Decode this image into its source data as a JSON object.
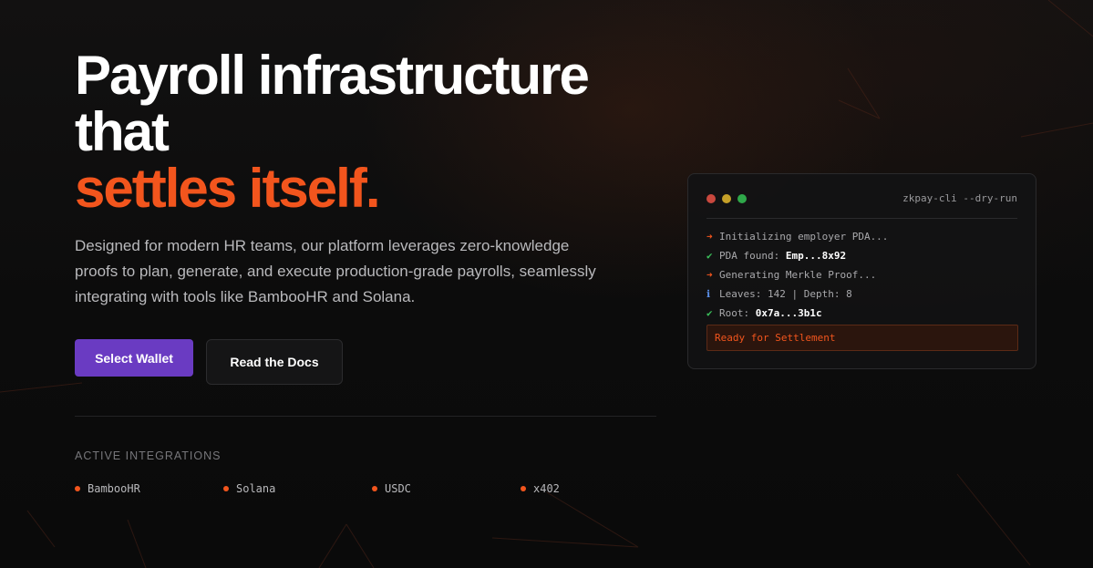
{
  "colors": {
    "accent": "#f2551d",
    "primary_button": "#6a3bc2",
    "background": "#0b0b0c",
    "term_red": "#c9483e",
    "term_yellow": "#c5a028",
    "term_green": "#2fa84a",
    "check_green": "#3bbf5a",
    "info_blue": "#5a8ee6"
  },
  "hero": {
    "line1": "Payroll infrastructure",
    "line2": "that",
    "line3": "settles itself.",
    "subtitle": "Designed for modern HR teams, our platform leverages zero-knowledge proofs to plan, generate, and execute production-grade payrolls, seamlessly integrating with tools like BambooHR and Solana."
  },
  "buttons": {
    "primary_label": "Select Wallet",
    "secondary_label": "Read the Docs"
  },
  "integrations": {
    "title": "ACTIVE INTEGRATIONS",
    "items": [
      {
        "label": "BambooHR",
        "icon": "orange-dot"
      },
      {
        "label": "Solana",
        "icon": "orange-dot"
      },
      {
        "label": "USDC",
        "icon": "orange-dot"
      },
      {
        "label": "x402",
        "icon": "orange-dot"
      }
    ]
  },
  "terminal": {
    "title": "zkpay-cli --dry-run",
    "lines": [
      {
        "symbol": "➜",
        "symbol_color": "#f2551d",
        "text": "Initializing employer PDA...",
        "value": ""
      },
      {
        "symbol": "✔",
        "symbol_color": "#3bbf5a",
        "text": "PDA found: ",
        "value": "Emp...8x92"
      },
      {
        "symbol": "➜",
        "symbol_color": "#f2551d",
        "text": "Generating Merkle Proof...",
        "value": ""
      },
      {
        "symbol": "ℹ",
        "symbol_color": "#5a8ee6",
        "text": "Leaves: 142 | Depth: 8",
        "value": ""
      },
      {
        "symbol": "✔",
        "symbol_color": "#3bbf5a",
        "text": "Root: ",
        "value": "0x7a...3b1c"
      }
    ],
    "status": "Ready for Settlement"
  }
}
